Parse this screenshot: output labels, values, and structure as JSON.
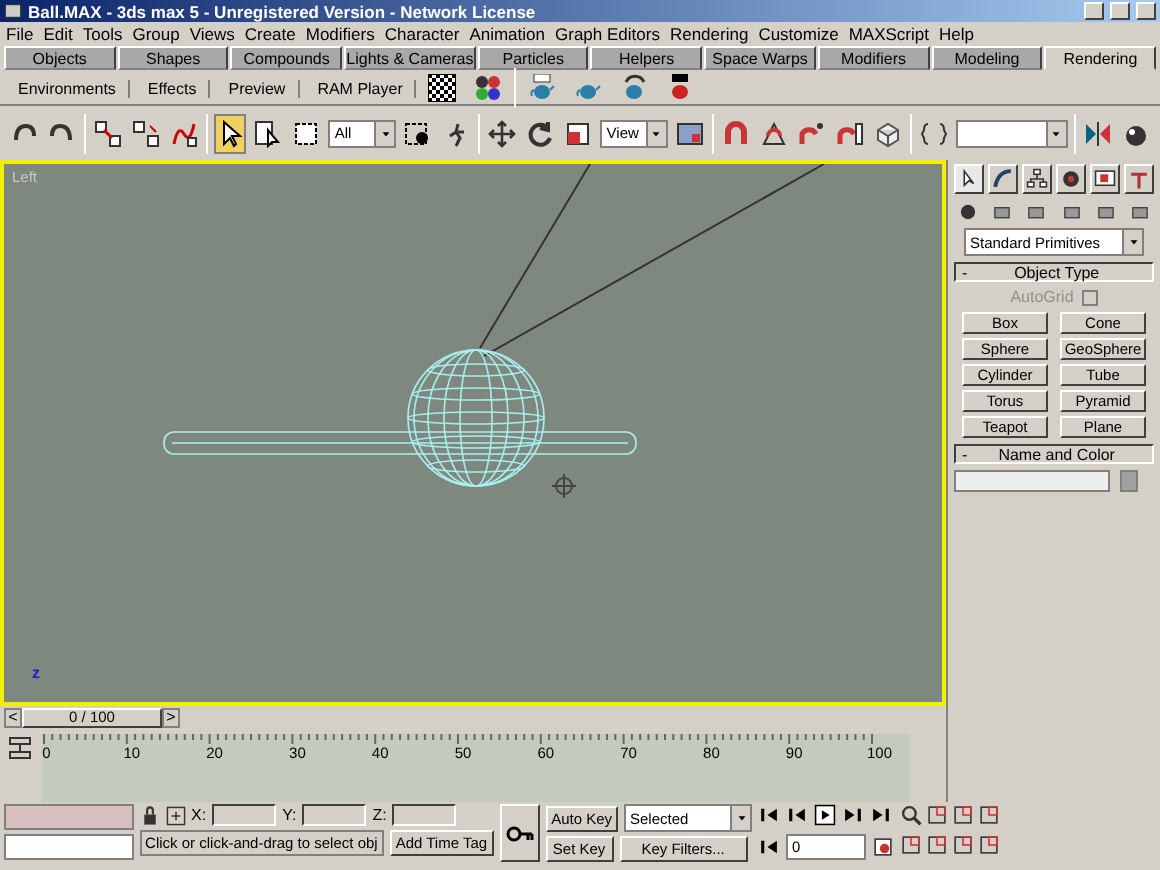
{
  "window": {
    "title": "Ball.MAX - 3ds max 5 - Unregistered Version - Network License"
  },
  "menu": [
    "File",
    "Edit",
    "Tools",
    "Group",
    "Views",
    "Create",
    "Modifiers",
    "Character",
    "Animation",
    "Graph Editors",
    "Rendering",
    "Customize",
    "MAXScript",
    "Help"
  ],
  "tabs": [
    {
      "label": "Objects",
      "selected": false
    },
    {
      "label": "Shapes",
      "selected": false
    },
    {
      "label": "Compounds",
      "selected": false
    },
    {
      "label": "Lights & Cameras",
      "selected": false
    },
    {
      "label": "Particles",
      "selected": false
    },
    {
      "label": "Helpers",
      "selected": false
    },
    {
      "label": "Space Warps",
      "selected": false
    },
    {
      "label": "Modifiers",
      "selected": false
    },
    {
      "label": "Modeling",
      "selected": false
    },
    {
      "label": "Rendering",
      "selected": true
    }
  ],
  "tab_toolbar": {
    "buttons": [
      "Environments",
      "Effects",
      "Preview",
      "RAM Player"
    ]
  },
  "main_toolbar": [
    {
      "kind": "undo",
      "selected": false
    },
    {
      "kind": "redo",
      "selected": false
    },
    {
      "kind": "sep"
    },
    {
      "kind": "link",
      "selected": false
    },
    {
      "kind": "unlink",
      "selected": false
    },
    {
      "kind": "bind",
      "selected": false
    },
    {
      "kind": "sep"
    },
    {
      "kind": "select",
      "selected": true
    },
    {
      "kind": "select-by-name",
      "selected": false
    },
    {
      "kind": "region",
      "selected": false
    },
    {
      "kind": "dropdown",
      "value": "All"
    },
    {
      "kind": "window",
      "selected": false
    },
    {
      "kind": "figure",
      "selected": false
    },
    {
      "kind": "sep"
    },
    {
      "kind": "move",
      "selected": false
    },
    {
      "kind": "rotate",
      "selected": false
    },
    {
      "kind": "scale",
      "selected": false
    },
    {
      "kind": "dropdown",
      "value": "View"
    },
    {
      "kind": "pivot",
      "selected": false
    },
    {
      "kind": "sep"
    },
    {
      "kind": "snap",
      "selected": false
    },
    {
      "kind": "angle-snap",
      "selected": false
    },
    {
      "kind": "percent-snap",
      "selected": false
    },
    {
      "kind": "spinner-snap",
      "selected": false
    },
    {
      "kind": "box",
      "selected": false
    },
    {
      "kind": "sep"
    },
    {
      "kind": "edit-named",
      "selected": false
    },
    {
      "kind": "dropdown"
    },
    {
      "kind": "sep"
    },
    {
      "kind": "mirror",
      "selected": false
    },
    {
      "kind": "align",
      "selected": false
    }
  ],
  "viewport": {
    "label": "Left",
    "active": true,
    "axis": "z"
  },
  "command_panel": {
    "dropdown": "Standard Primitives",
    "object_type": {
      "title": "Object Type",
      "toggle": "-",
      "autogrid": {
        "label": "AutoGrid",
        "checked": false,
        "disabled": true
      },
      "buttons": [
        "Box",
        "Cone",
        "Sphere",
        "GeoSphere",
        "Cylinder",
        "Tube",
        "Torus",
        "Pyramid",
        "Teapot",
        "Plane"
      ]
    },
    "name_and_color": {
      "title": "Name and Color",
      "toggle": "-"
    }
  },
  "time_slider": {
    "left": "<",
    "frame": "0 / 100",
    "right": ">"
  },
  "track_bar": {
    "ticks": [
      "0",
      "10",
      "20",
      "30",
      "40",
      "50",
      "60",
      "70",
      "80",
      "90",
      "100"
    ]
  },
  "status": {
    "x_label": "X:",
    "y_label": "Y:",
    "z_label": "Z:",
    "prompt": "Click or click-and-drag to select obj",
    "add_time_tag": "Add Time Tag",
    "auto_key": {
      "label": "Auto Key",
      "on": false
    },
    "set_key": "Set Key",
    "key_mode": "Selected",
    "key_filters": "Key Filters...",
    "frame": "0"
  }
}
